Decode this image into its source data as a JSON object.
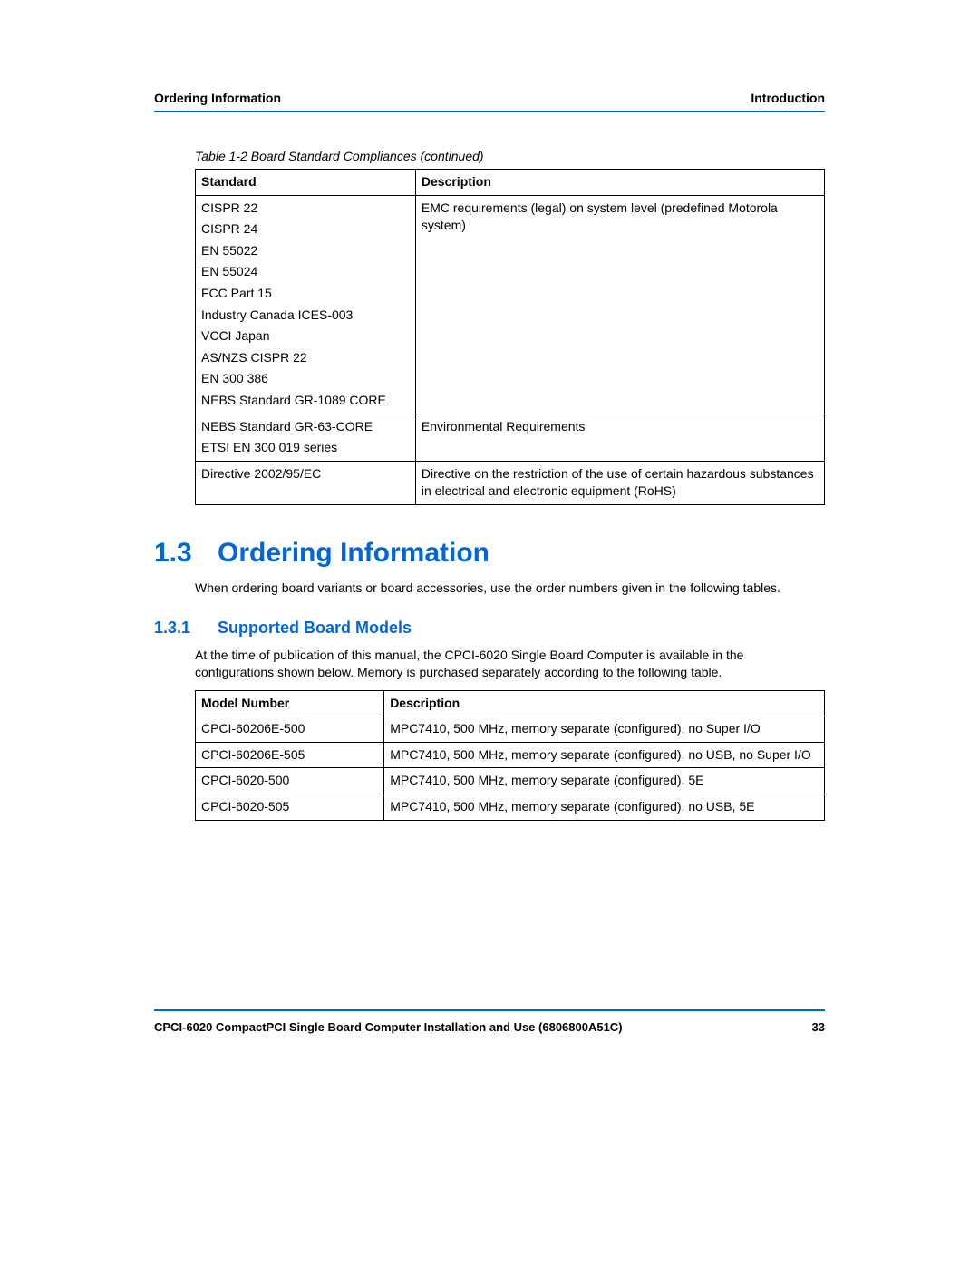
{
  "header": {
    "left": "Ordering Information",
    "right": "Introduction"
  },
  "table1": {
    "caption": "Table 1-2 Board Standard Compliances (continued)",
    "headers": {
      "standard": "Standard",
      "description": "Description"
    },
    "rows": [
      {
        "standards": [
          "CISPR 22",
          "CISPR 24",
          "EN 55022",
          "EN 55024",
          "FCC Part 15",
          "Industry Canada ICES-003",
          "VCCI Japan",
          "AS/NZS CISPR 22",
          "EN 300 386",
          "NEBS Standard GR-1089 CORE"
        ],
        "description": "EMC requirements (legal) on system level (predefined Motorola system)"
      },
      {
        "standards": [
          "NEBS Standard GR-63-CORE",
          "ETSI EN 300 019 series"
        ],
        "description": "Environmental Requirements"
      },
      {
        "standards": [
          "Directive 2002/95/EC"
        ],
        "description": "Directive on the restriction of the use of certain hazardous substances in electrical and electronic equipment (RoHS)"
      }
    ]
  },
  "section": {
    "num": "1.3",
    "title": "Ordering Information",
    "intro": "When ordering board variants or board accessories, use the order numbers given in the following tables."
  },
  "subsection": {
    "num": "1.3.1",
    "title": "Supported Board Models",
    "intro": "At the time of publication of this manual, the CPCI-6020 Single Board Computer is available in the configurations shown below. Memory is purchased separately according to the following table."
  },
  "table2": {
    "headers": {
      "model": "Model Number",
      "description": "Description"
    },
    "rows": [
      {
        "model": "CPCI-60206E-500",
        "description": "MPC7410, 500 MHz, memory separate (configured), no Super I/O"
      },
      {
        "model": "CPCI-60206E-505",
        "description": "MPC7410, 500 MHz, memory separate (configured), no USB, no Super I/O"
      },
      {
        "model": "CPCI-6020-500",
        "description": "MPC7410, 500 MHz, memory separate (configured), 5E"
      },
      {
        "model": "CPCI-6020-505",
        "description": "MPC7410, 500 MHz, memory separate (configured), no USB, 5E"
      }
    ]
  },
  "footer": {
    "left": "CPCI-6020 CompactPCI Single Board Computer Installation and Use (6806800A51C)",
    "right": "33"
  }
}
